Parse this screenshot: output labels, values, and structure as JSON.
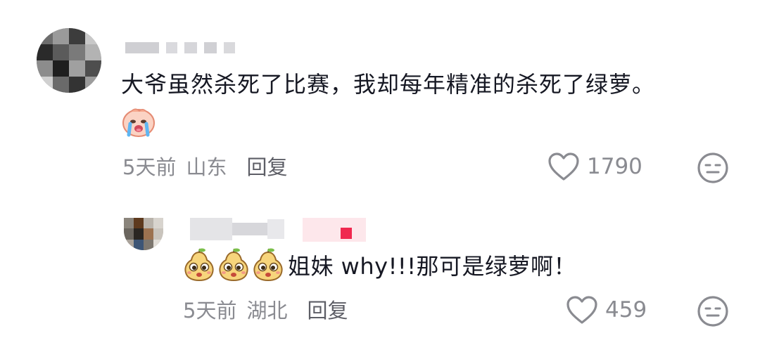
{
  "comment": {
    "text": "大爷虽然杀死了比赛，我却每年精准的杀死了绿萝。",
    "emoji": "crying-emoji",
    "date": "5天前",
    "region": "山东",
    "reply_label": "回复",
    "likes": "1790"
  },
  "reply": {
    "emojis": [
      "pear-face-emoji",
      "pear-face-emoji",
      "pear-face-emoji"
    ],
    "text": "姐妹 why!!!那可是绿萝啊！",
    "date": "5天前",
    "region": "湖北",
    "reply_label": "回复",
    "likes": "459"
  },
  "colors": {
    "text_primary": "#161823",
    "text_secondary": "#8a8b91",
    "reply_link": "#5d5e66",
    "badge_red": "#f0284f"
  },
  "icons": {
    "like": "heart-outline-icon",
    "dislike": "meh-face-icon"
  }
}
